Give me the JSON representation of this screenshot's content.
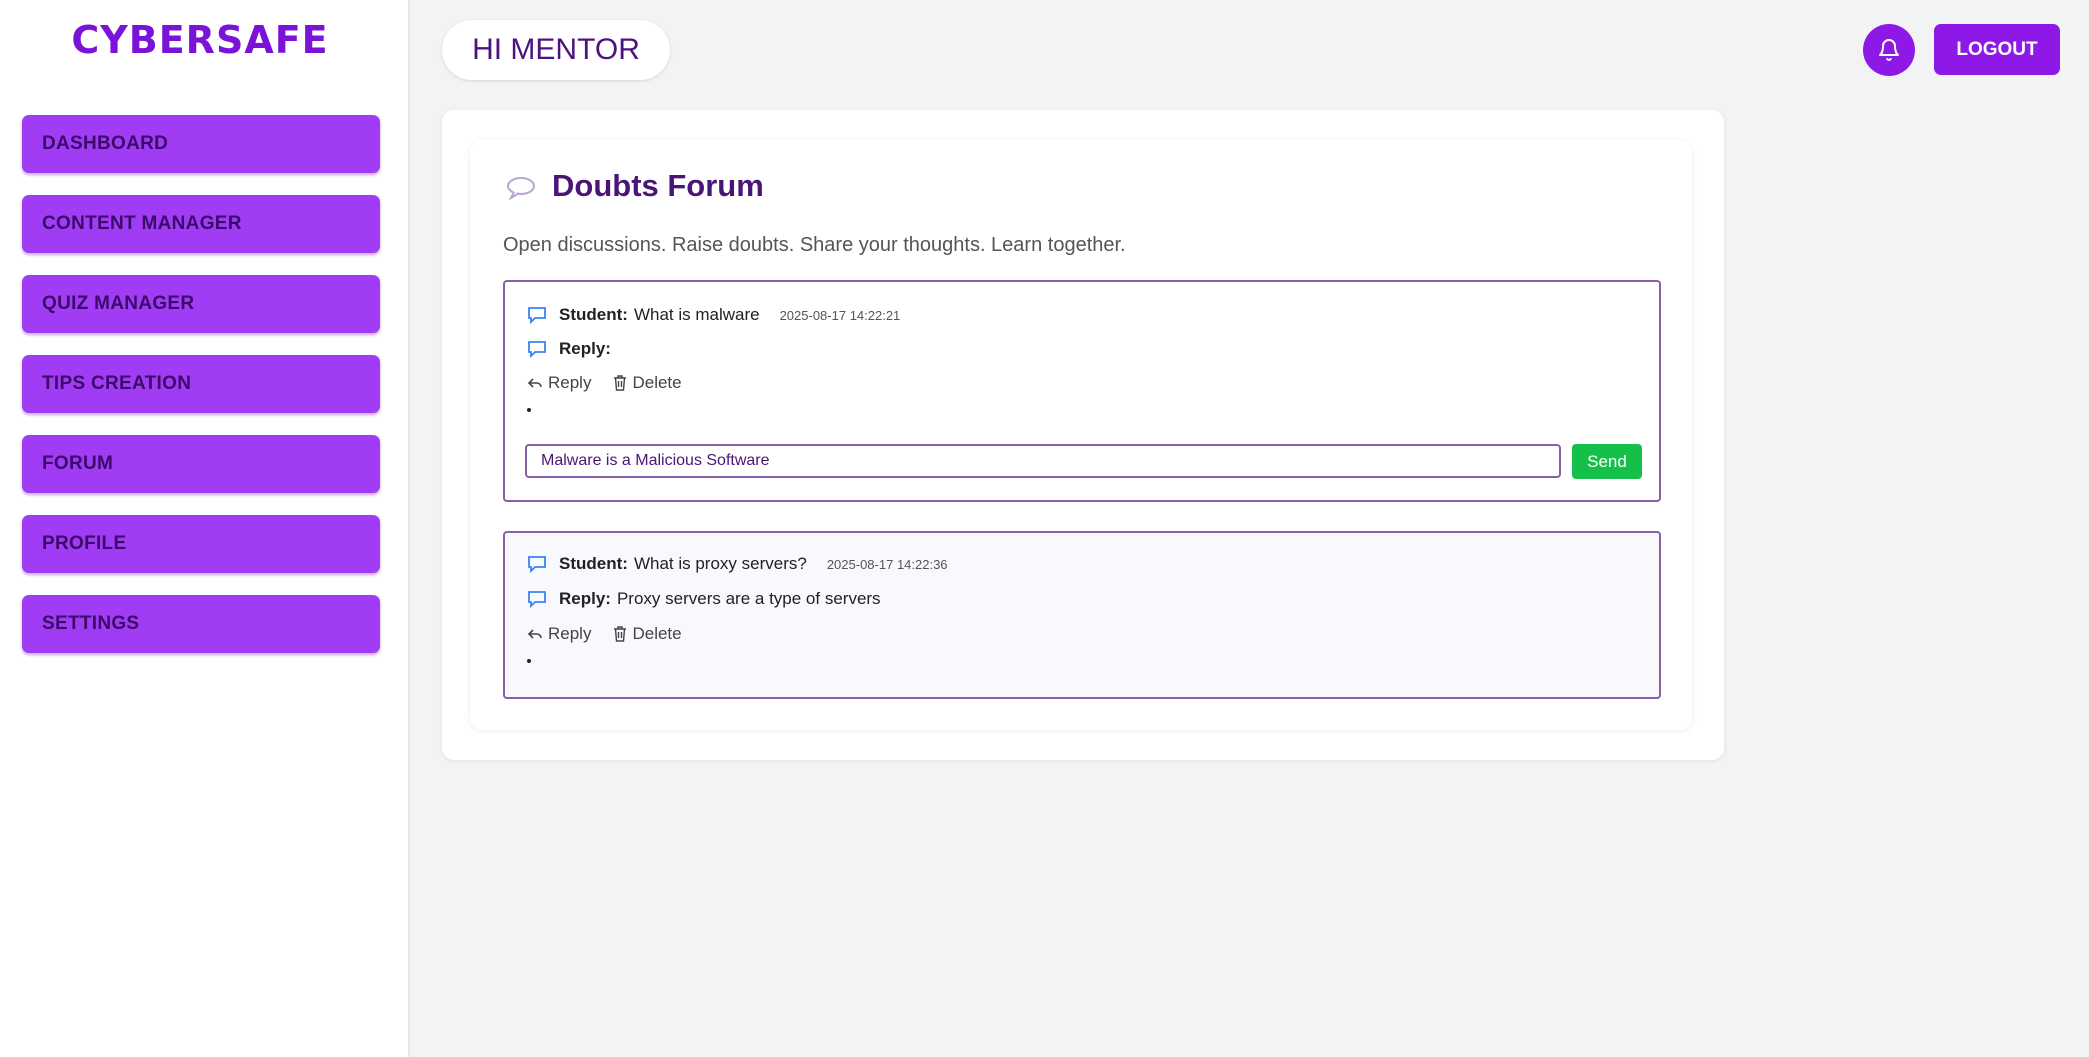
{
  "sidebar": {
    "brand": "CYBERSAFE",
    "items": [
      {
        "label": "DASHBOARD"
      },
      {
        "label": "CONTENT MANAGER"
      },
      {
        "label": "QUIZ MANAGER"
      },
      {
        "label": "TIPS CREATION"
      },
      {
        "label": "FORUM"
      },
      {
        "label": "PROFILE"
      },
      {
        "label": "SETTINGS"
      }
    ]
  },
  "header": {
    "greeting": "HI MENTOR",
    "logout_label": "LOGOUT",
    "bell_icon": "bell-icon"
  },
  "forum": {
    "title_icon": "speech-bubble-icon",
    "title": "Doubts Forum",
    "subtitle": "Open discussions. Raise doubts. Share your thoughts. Learn together.",
    "threads": [
      {
        "student_label": "Student:",
        "question": "What is malware",
        "timestamp": "2025-08-17 14:22:21",
        "reply_label": "Reply:",
        "reply_text": "",
        "reply_action": "Reply",
        "delete_action": "Delete",
        "reply_input_value": "Malware is a Malicious Software",
        "send_label": "Send"
      },
      {
        "student_label": "Student:",
        "question": "What is proxy servers?",
        "timestamp": "2025-08-17 14:22:36",
        "reply_label": "Reply:",
        "reply_text": "Proxy servers are a type of servers",
        "reply_action": "Reply",
        "delete_action": "Delete"
      }
    ]
  },
  "colors": {
    "brand": "#7a12d8",
    "nav_button": "#a13cf5",
    "accent": "#8e18e6",
    "send": "#14c04a"
  }
}
